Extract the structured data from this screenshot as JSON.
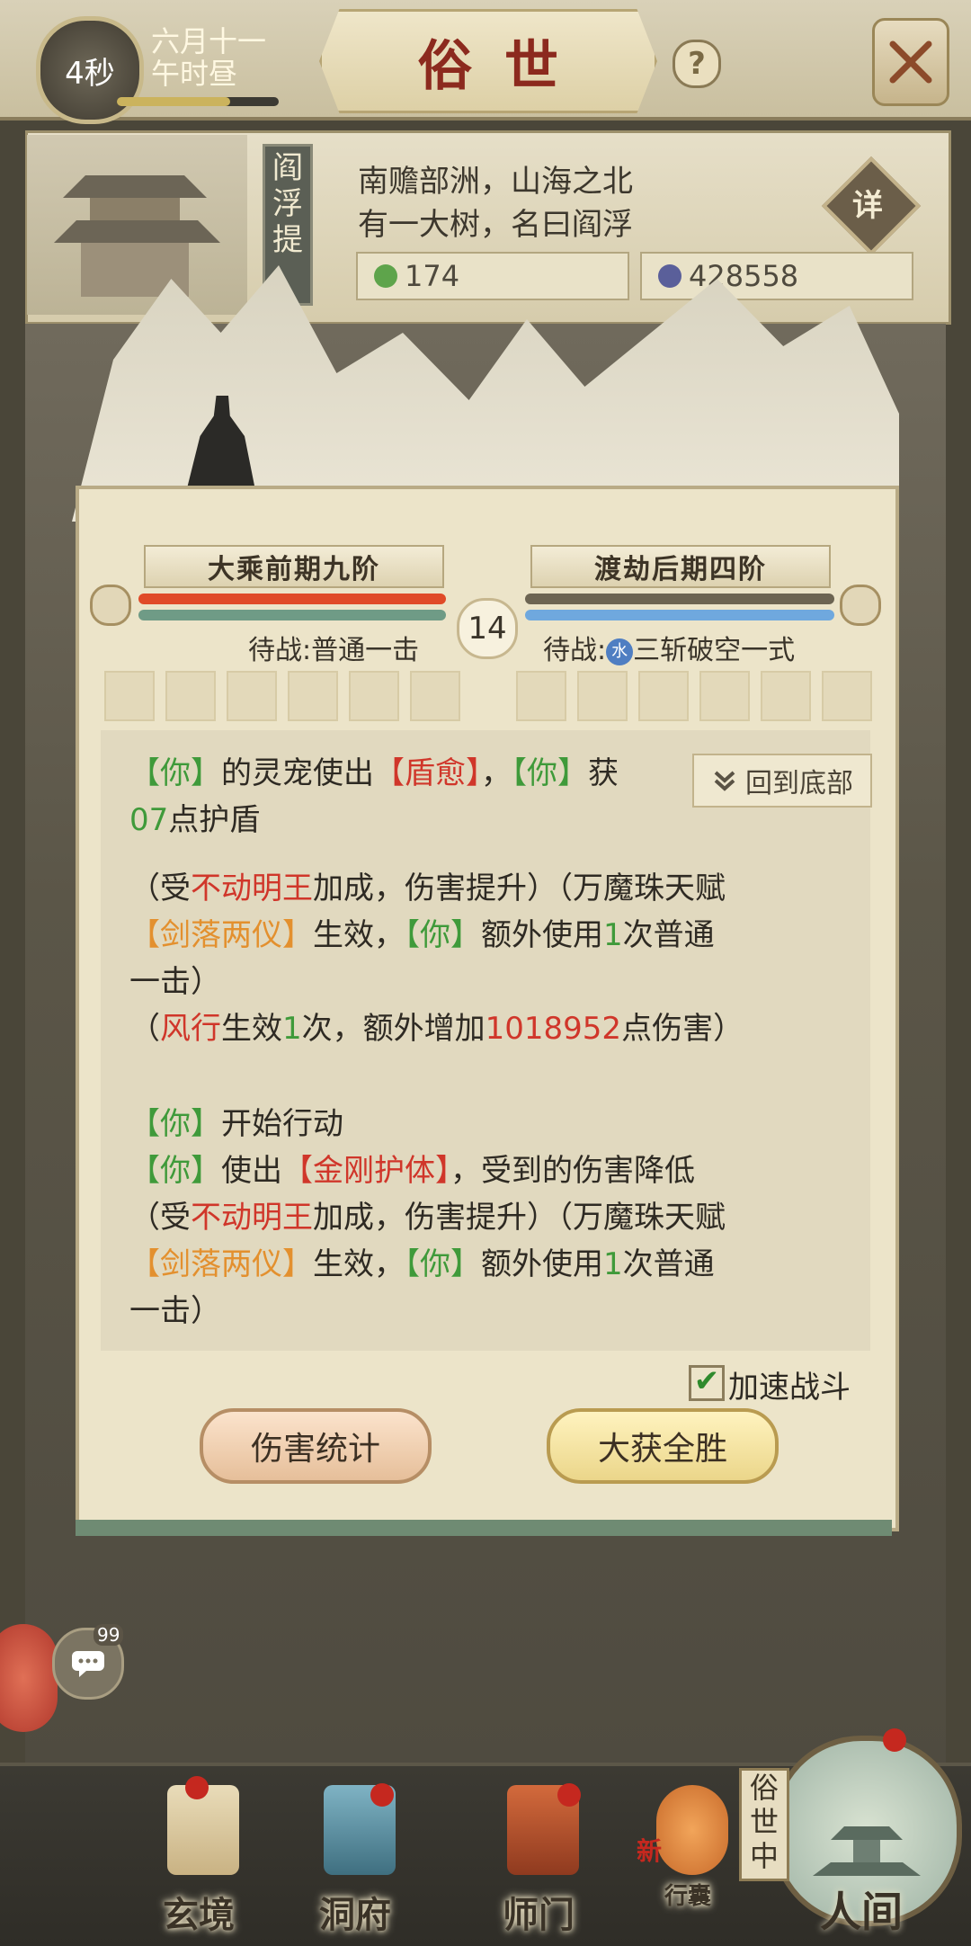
{
  "top": {
    "timer": "4秒",
    "date_line1": "六月十一",
    "date_line2": "午时昼",
    "title": "俗世",
    "help": "?"
  },
  "location": {
    "banner": "阎浮提",
    "desc_line1": "南赡部洲，山海之北",
    "desc_line2": "有一大树，名曰阎浮",
    "detail_btn": "详",
    "resource1_value": "174",
    "resource2_value": "428558"
  },
  "battle": {
    "left_rank": "大乘前期九阶",
    "right_rank": "渡劫后期四阶",
    "turn": "14",
    "left_waiting": "待战:普通一击",
    "right_waiting_prefix": "待战:",
    "water_badge": "水",
    "right_waiting_skill": "三斩破空一式",
    "back_to_bottom": "回到底部",
    "speed_label": "加速战斗",
    "speed_checked": true,
    "btn_stats": "伤害统计",
    "btn_victory": "大获全胜"
  },
  "log": {
    "l1_a": "【你】",
    "l1_b": "的灵宠使出",
    "l1_c": "【盾愈】",
    "l1_d": "，",
    "l1_e": "【你】",
    "l1_f": "获",
    "l2_a": "07",
    "l2_b": "点护盾",
    "l3_a": "（受",
    "l3_b": "不动明王",
    "l3_c": "加成，伤害提升）（万魔珠天赋",
    "l4_a": "【剑落两仪】",
    "l4_b": "生效，",
    "l4_c": "【你】",
    "l4_d": "额外使用",
    "l4_e": "1",
    "l4_f": "次普通",
    "l5_a": "一击）",
    "l6_a": "（",
    "l6_b": "风行",
    "l6_c": "生效",
    "l6_d": "1",
    "l6_e": "次，额外增加",
    "l6_f": "1018952",
    "l6_g": "点伤害）",
    "l7_a": "【你】",
    "l7_b": "开始行动",
    "l8_a": "【你】",
    "l8_b": "使出",
    "l8_c": "【金刚护体】",
    "l8_d": "，受到的伤害降低",
    "l9_a": "（受",
    "l9_b": "不动明王",
    "l9_c": "加成，伤害提升）（万魔珠天赋",
    "l10_a": "【剑落两仪】",
    "l10_b": "生效，",
    "l10_c": "【你】",
    "l10_d": "额外使用",
    "l10_e": "1",
    "l10_f": "次普通",
    "l11_a": "一击）"
  },
  "side": {
    "chat_count": "99"
  },
  "nav": {
    "item1": "玄境",
    "item2": "洞府",
    "item3": "师门",
    "item4": "行囊",
    "item4_badge": "新",
    "item5": "人间",
    "human_tag": "俗世中"
  },
  "colors": {
    "green_text": "#3f9a3a",
    "red_text": "#d0362a",
    "orange_text": "#e3902e",
    "panel_bg": "#ece4c9"
  }
}
